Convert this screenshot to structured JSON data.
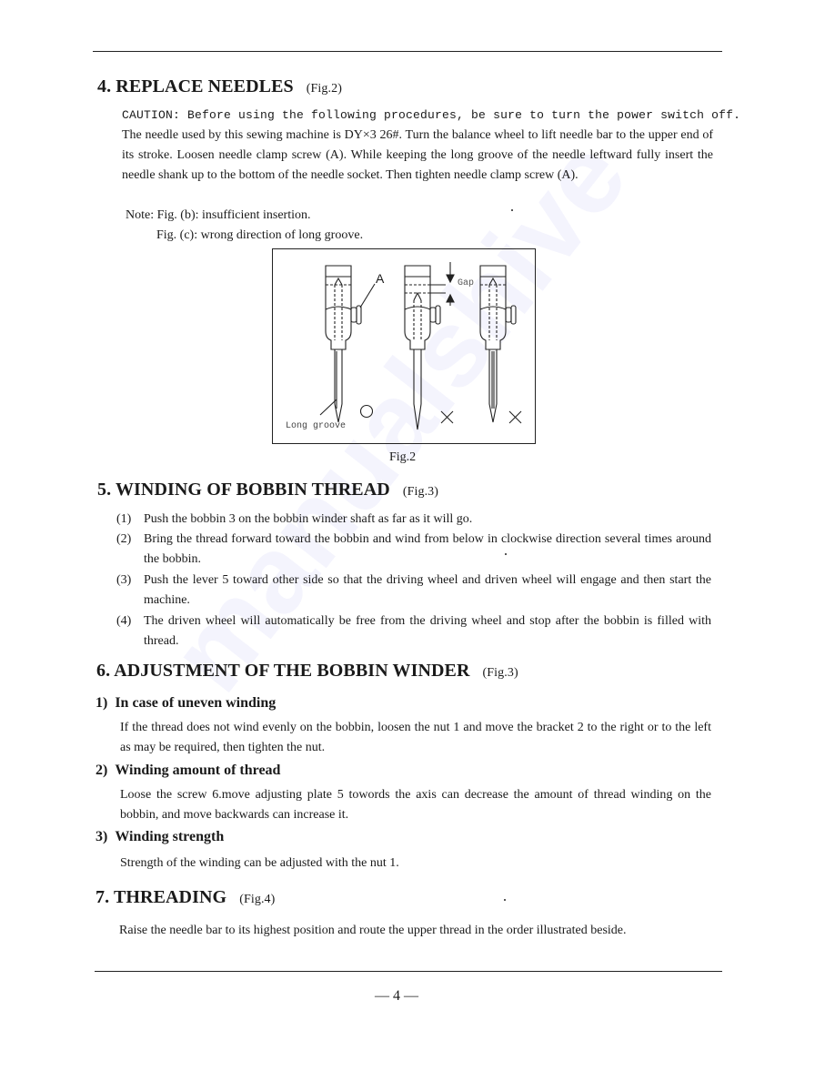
{
  "watermark": "manualshive",
  "section4": {
    "title": "4. REPLACE NEEDLES",
    "fig_ref": "(Fig.2)",
    "caution": "CAUTION: Before using the following procedures, be sure to turn the power switch off.",
    "body": "The needle used by this sewing machine is DY×3 26#. Turn the balance wheel to lift needle bar to the upper end of its stroke. Loosen needle clamp screw (A). While keeping the long groove of the needle leftward fully insert the needle shank up to the bottom of the needle socket. Then tighten needle clamp screw (A).",
    "note_b": "Note: Fig. (b): insufficient insertion.",
    "note_c": "Fig. (c): wrong direction of long groove.",
    "figure": {
      "label_a": "A",
      "label_gap": "Gap",
      "label_long_groove": "Long groove",
      "mark_correct": "○",
      "mark_wrong_b": "×",
      "mark_wrong_c": "×",
      "caption": "Fig.2"
    }
  },
  "section5": {
    "title": "5. WINDING OF BOBBIN THREAD",
    "fig_ref": "(Fig.3)",
    "items": [
      {
        "num": "(1)",
        "text": "Push the bobbin 3 on the bobbin winder shaft as far as it will go."
      },
      {
        "num": "(2)",
        "text": "Bring the thread forward toward the bobbin and wind from below in clockwise direction several times around the bobbin."
      },
      {
        "num": "(3)",
        "text": "Push the lever 5 toward other side so that the driving wheel and driven wheel will engage and then start the machine."
      },
      {
        "num": "(4)",
        "text": "The driven wheel will automatically be free from the driving wheel and stop after the bobbin is filled with thread."
      }
    ]
  },
  "section6": {
    "title": "6. ADJUSTMENT OF THE BOBBIN WINDER",
    "fig_ref": "(Fig.3)",
    "subs": [
      {
        "num": "1)",
        "title": "In case of uneven winding",
        "text": "If the thread does not wind evenly on the bobbin, loosen the nut 1 and move the bracket 2 to the right or to the left as may be required, then tighten the nut."
      },
      {
        "num": "2)",
        "title": "Winding amount of thread",
        "text": "Loose the screw 6.move adjusting plate 5 towords the axis can decrease the amount of thread winding on the bobbin, and move backwards can increase it."
      },
      {
        "num": "3)",
        "title": "Winding strength",
        "text": "Strength of the winding can be adjusted with the nut 1."
      }
    ]
  },
  "section7": {
    "title": "7. THREADING",
    "fig_ref": "(Fig.4)",
    "text": "Raise the needle bar to its highest position and route the upper thread in the order illustrated beside."
  },
  "footer": {
    "page_number": "— 4 —"
  }
}
